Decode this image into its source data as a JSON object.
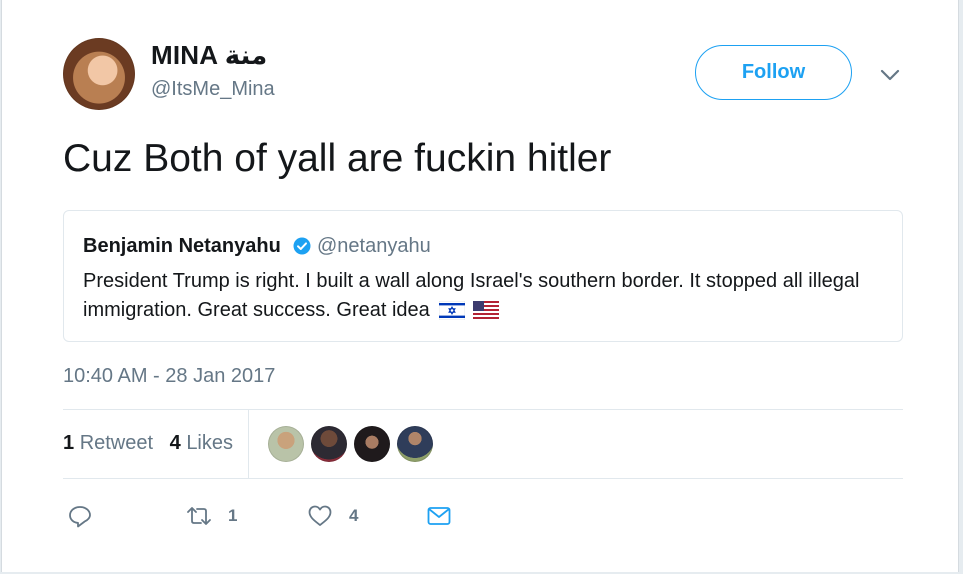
{
  "author": {
    "name": "MINA منة",
    "handle": "@ItsMe_Mina"
  },
  "follow_label": "Follow",
  "tweet_text": "Cuz Both of yall are fuckin hitler",
  "quoted": {
    "name": "Benjamin Netanyahu",
    "handle": "@netanyahu",
    "text": "President Trump is right. I built a wall along Israel's southern border. It stopped all illegal immigration. Great success. Great idea",
    "flags": [
      "israel-flag-icon",
      "us-flag-icon"
    ]
  },
  "timestamp": "10:40 AM - 28 Jan 2017",
  "stats": {
    "retweet_count": "1",
    "retweet_label": "Retweet",
    "like_count": "4",
    "like_label": "Likes"
  },
  "actions": {
    "retweet_count": "1",
    "like_count": "4"
  },
  "colors": {
    "accent": "#1da1f2",
    "muted": "#657786",
    "border": "#e1e8ed"
  },
  "icons": [
    "chevron-down-icon",
    "verified-badge-icon",
    "reply-icon",
    "retweet-icon",
    "like-icon",
    "message-icon"
  ]
}
